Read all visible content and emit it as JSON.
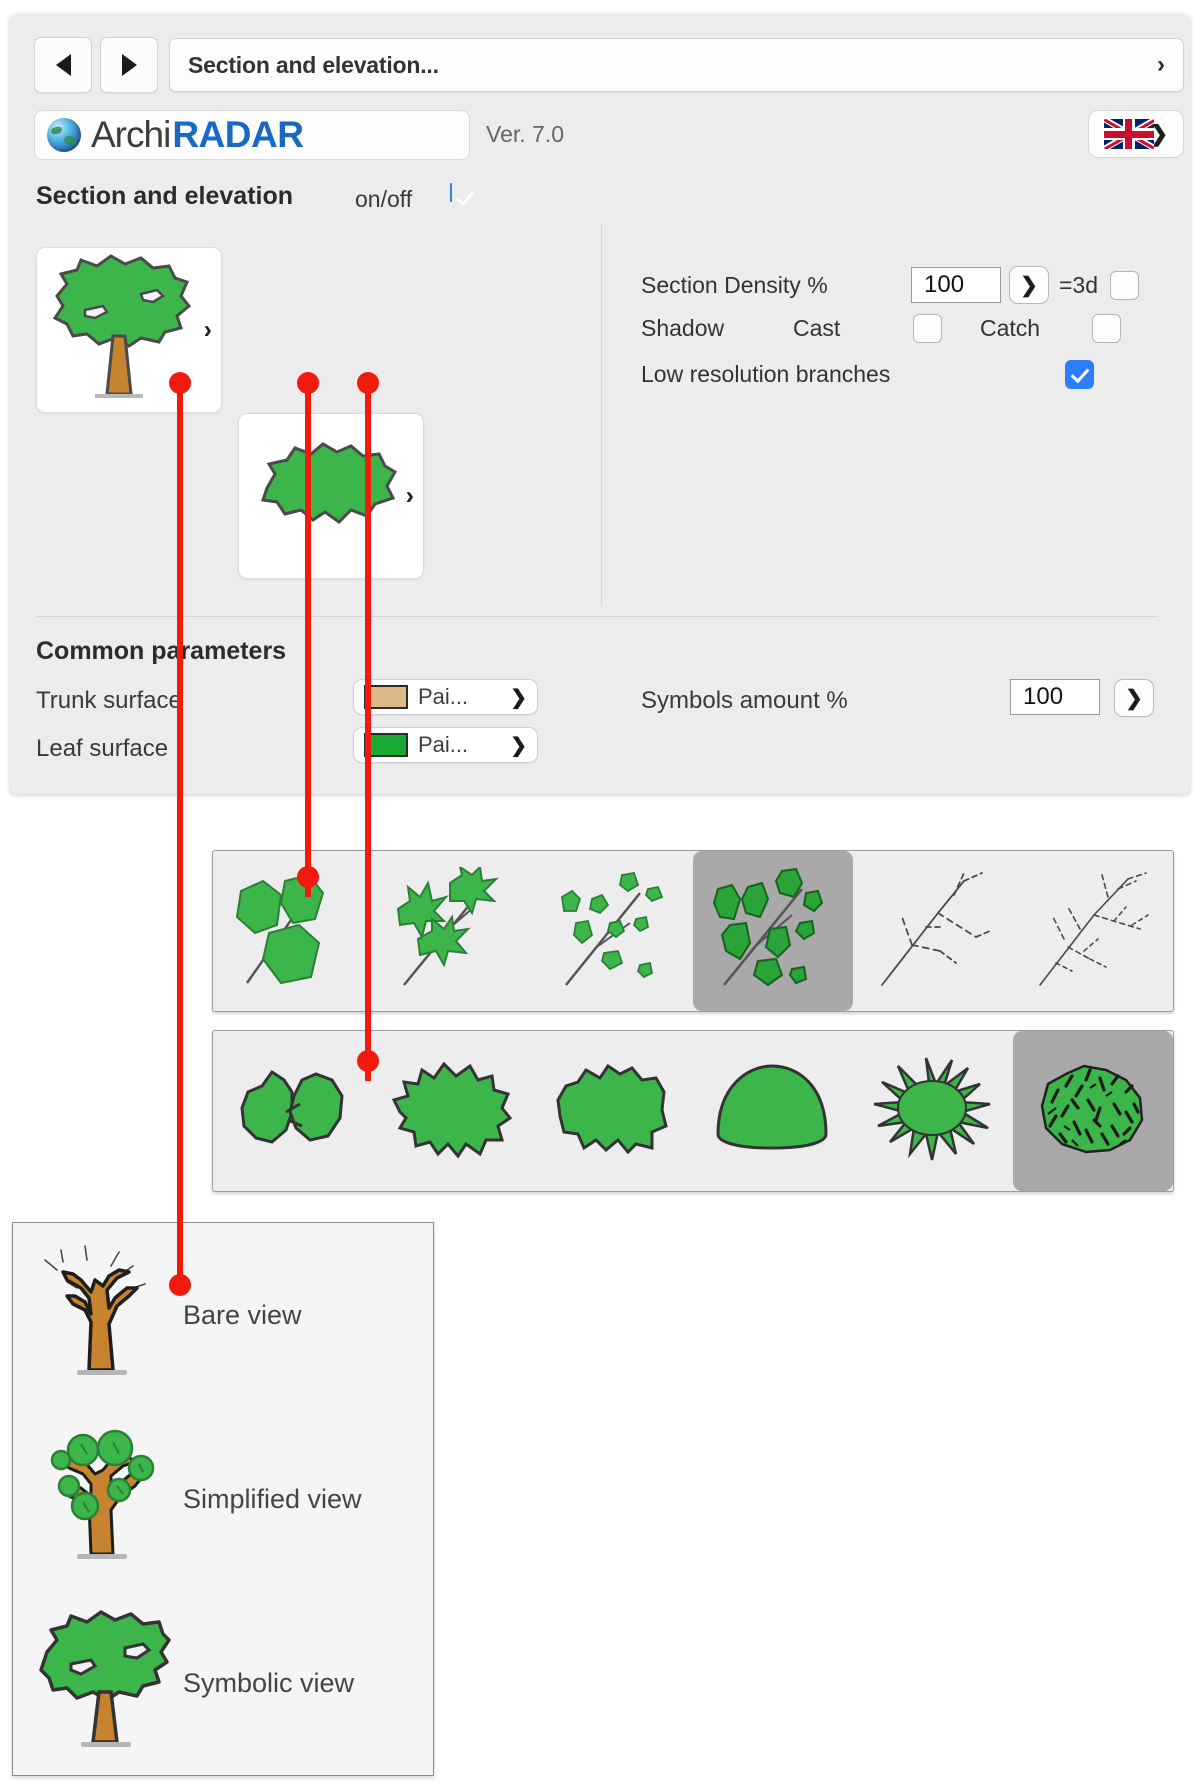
{
  "window": {
    "nav": {
      "back_label": "back",
      "forward_label": "forward",
      "title": "Section and elevation...",
      "expand_chevron": "›"
    },
    "brand": {
      "name_part1": "Archi",
      "name_part2": "RADAR",
      "version": "Ver. 7.0",
      "language_flag": "uk-flag",
      "flag_chevron": "❯"
    }
  },
  "section": {
    "title": "Section and elevation",
    "onoff_label": "on/off",
    "onoff_checked": true,
    "thumb_chevron": "›",
    "thumbnails": [
      {
        "name": "symbolic-tree-preview"
      },
      {
        "name": "crown-plan-preview"
      }
    ]
  },
  "params": {
    "section_density_label": "Section Density %",
    "section_density_value": "100",
    "section_density_stepper": "❯",
    "is3d_label": "=3d",
    "is3d_checked": false,
    "shadow_label": "Shadow",
    "cast_label": "Cast",
    "cast_checked": false,
    "catch_label": "Catch",
    "catch_checked": false,
    "low_res_label": "Low resolution branches",
    "low_res_checked": true
  },
  "common": {
    "title": "Common parameters",
    "trunk_label": "Trunk surface",
    "trunk_value": "Pai...",
    "trunk_color": "#ddb888",
    "leaf_label": "Leaf surface",
    "leaf_value": "Pai...",
    "leaf_color": "#19aa32",
    "surface_chevron": "❯",
    "symbols_amount_label": "Symbols amount %",
    "symbols_amount_value": "100",
    "symbols_amount_stepper": "❯"
  },
  "palettes": {
    "leaf_symbols": {
      "name": "leaf-symbol-palette",
      "selected_index": 3,
      "items": [
        {
          "name": "leaf-broad-polygon"
        },
        {
          "name": "leaf-maple-spiky"
        },
        {
          "name": "leaf-small-scattered"
        },
        {
          "name": "leaf-medium-oval"
        },
        {
          "name": "branch-bare-sparse"
        },
        {
          "name": "branch-bare-dense"
        }
      ]
    },
    "crown_shapes": {
      "name": "crown-shape-palette",
      "selected_index": 5,
      "items": [
        {
          "name": "crown-split-lobes"
        },
        {
          "name": "crown-spiky-wide"
        },
        {
          "name": "crown-bumpy-flat"
        },
        {
          "name": "crown-smooth-dome"
        },
        {
          "name": "crown-starburst"
        },
        {
          "name": "crown-textured-dense"
        }
      ]
    }
  },
  "legend": {
    "name": "view-modes-legend",
    "items": [
      {
        "icon": "bare-tree-icon",
        "label": "Bare view"
      },
      {
        "icon": "simplified-tree-icon",
        "label": "Simplified view"
      },
      {
        "icon": "symbolic-tree-icon",
        "label": "Symbolic view"
      }
    ]
  },
  "annotations": {
    "color": "#f01b0c",
    "callouts": [
      {
        "name": "callout-symbolic-view"
      },
      {
        "name": "callout-crown-shape"
      },
      {
        "name": "callout-leaf-symbol"
      }
    ]
  }
}
